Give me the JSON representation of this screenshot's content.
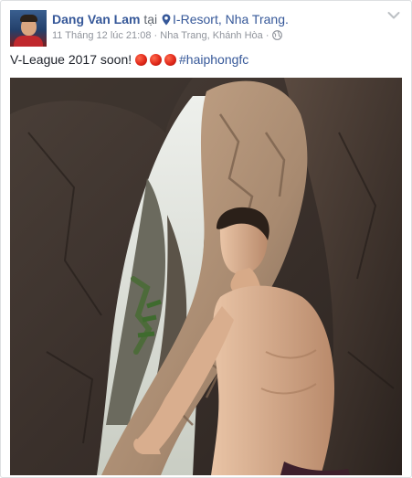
{
  "post": {
    "author": "Dang Van Lam",
    "location_prefix": "tại",
    "location": "I-Resort, Nha Trang.",
    "timestamp": "11 Tháng 12 lúc 21:08",
    "place": "Nha Trang, Khánh Hòa",
    "separator": "·",
    "privacy_icon": "globe-icon",
    "menu_icon": "chevron-down-icon",
    "text": "V-League 2017 soon!",
    "emoji": [
      "red-circle",
      "red-circle",
      "red-circle"
    ],
    "hashtag": "#haiphongfc"
  },
  "colors": {
    "link": "#365899",
    "meta": "#90949c",
    "text": "#1d2129",
    "border": "#dddfe2"
  }
}
